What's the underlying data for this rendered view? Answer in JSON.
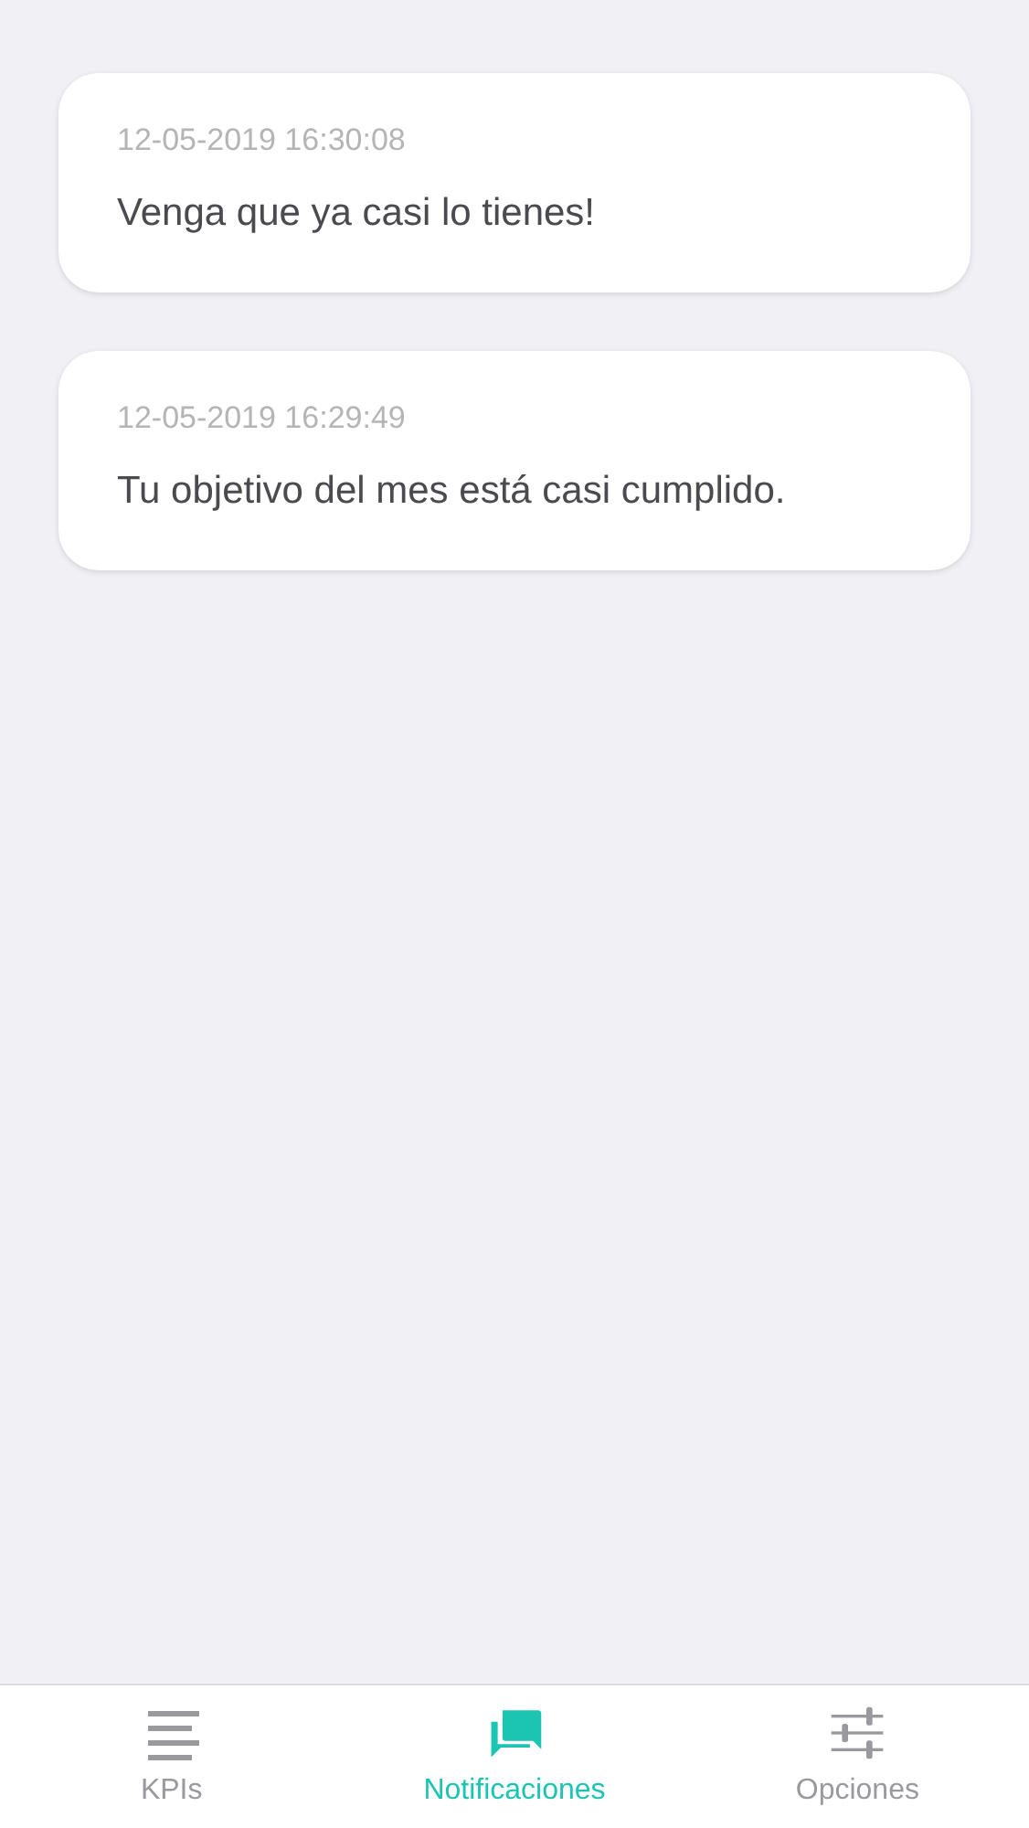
{
  "notifications": [
    {
      "timestamp": "12-05-2019 16:30:08",
      "message": "Venga que ya casi lo tienes!"
    },
    {
      "timestamp": "12-05-2019 16:29:49",
      "message": "Tu objetivo del mes está casi cumplido."
    }
  ],
  "tab_bar": [
    {
      "kind": "list",
      "label": "KPIs",
      "selected": false
    },
    {
      "kind": "chat",
      "label": "Notificaciones",
      "selected": true
    },
    {
      "kind": "sliders",
      "label": "Opciones",
      "selected": false
    }
  ]
}
